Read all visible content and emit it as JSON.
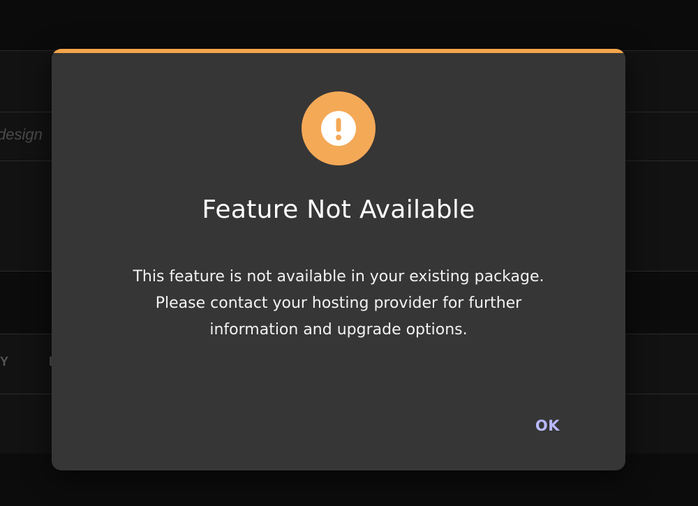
{
  "background": {
    "input_placeholder": "design",
    "column_letters": [
      "Y",
      "E"
    ]
  },
  "dialog": {
    "icon": "warning-exclamation-icon",
    "accent_color": "#f4a54a",
    "title": "Feature Not Available",
    "message_lines": [
      "This feature is not available in your existing package.",
      "Please contact your hosting provider for further",
      "information and upgrade options."
    ],
    "ok_label": "OK"
  }
}
